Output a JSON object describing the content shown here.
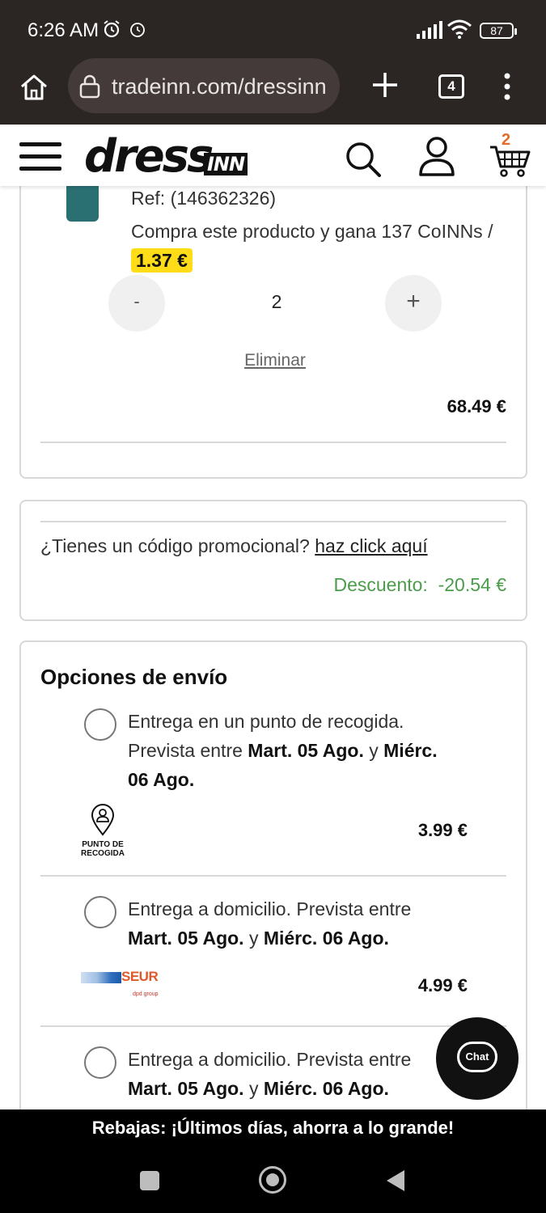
{
  "status_bar": {
    "time": "6:26 AM",
    "battery": "87"
  },
  "browser": {
    "url": "tradeinn.com/dressinn",
    "tab_count": "4"
  },
  "header": {
    "logo_text": "dress",
    "logo_suffix": "INN",
    "cart_count": "2"
  },
  "cart_item": {
    "ref": "Ref: (146362326)",
    "coinn_text": "Compra este producto y gana 137 CoINNs",
    "coinn_separator": "/",
    "coinn_value": "1.37 €",
    "decrease_label": "-",
    "quantity": "2",
    "increase_label": "+",
    "remove_label": "Eliminar",
    "line_total": "68.49 €"
  },
  "promo": {
    "question": "¿Tienes un código promocional?",
    "link_label": "haz click aquí",
    "discount_label": "Descuento:",
    "discount_value": "-20.54 €"
  },
  "shipping": {
    "title": "Opciones de envío",
    "options": [
      {
        "line1": "Entrega en un punto de recogida.",
        "pre": "Prevista entre",
        "date_from": "Mart. 05 Ago.",
        "connector": "y",
        "date_to_a": "Miérc.",
        "date_to_b": "06 Ago.",
        "carrier_label_1": "PUNTO DE",
        "carrier_label_2": "RECOGIDA",
        "price": "3.99 €"
      },
      {
        "line1": "Entrega a domicilio. Prevista entre",
        "date_from": "Mart. 05 Ago.",
        "connector": "y",
        "date_to": "Miérc. 06 Ago.",
        "carrier": "SEUR",
        "carrier_sub": "dpd group",
        "price": "4.99 €"
      },
      {
        "line1": "Entrega a domicilio. Prevista entre",
        "date_from": "Mart. 05 Ago.",
        "connector": "y",
        "date_to": "Miérc. 06 Ago."
      }
    ]
  },
  "chat": {
    "label": "Chat"
  },
  "banner": {
    "text": "Rebajas: ¡Últimos días, ahorra a lo grande!"
  },
  "colors": {
    "browser_chrome": "#2b2524",
    "coinn_badge": "#ffdc18",
    "discount": "#4b9c4b",
    "cart_count": "#e86a2b"
  }
}
